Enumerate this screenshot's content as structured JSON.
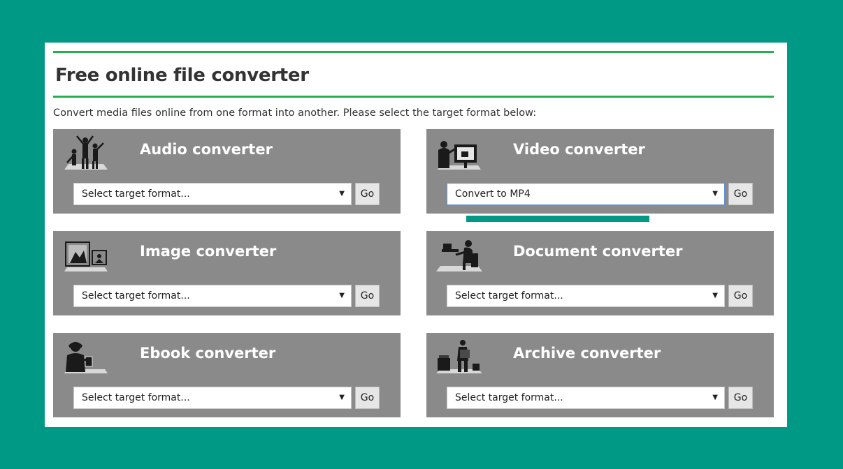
{
  "header": {
    "title": "Free online file converter",
    "subtitle": "Convert media files online from one format into another. Please select the target format below:"
  },
  "converters": [
    {
      "title": "Audio converter",
      "icon": "dancers-icon",
      "select_value": "Select target format...",
      "go_label": "Go"
    },
    {
      "title": "Video converter",
      "icon": "video-screen-icon",
      "select_value": "Convert to MP4",
      "go_label": "Go"
    },
    {
      "title": "Image converter",
      "icon": "photo-frame-icon",
      "select_value": "Select target format...",
      "go_label": "Go"
    },
    {
      "title": "Document converter",
      "icon": "desk-worker-icon",
      "select_value": "Select target format...",
      "go_label": "Go"
    },
    {
      "title": "Ebook converter",
      "icon": "reader-icon",
      "select_value": "Select target format...",
      "go_label": "Go"
    },
    {
      "title": "Archive converter",
      "icon": "archive-boxes-icon",
      "select_value": "Select target format...",
      "go_label": "Go"
    }
  ],
  "dropdown_arrow": "▼",
  "colors": {
    "background": "#009985",
    "accent_line": "#22b14c",
    "card": "#8a8a8a",
    "highlight_bar": "#009985"
  },
  "highlight_bar": {
    "progress": 1.0
  }
}
